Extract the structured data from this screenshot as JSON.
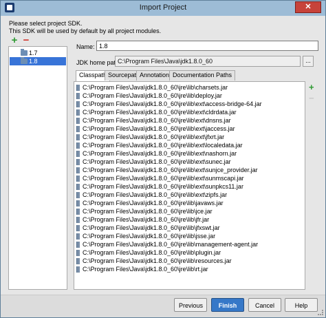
{
  "window": {
    "title": "Import Project",
    "close_glyph": "✕"
  },
  "header": {
    "line1": "Please select project SDK.",
    "line2": "This SDK will be used by default by all project modules."
  },
  "toolbar": {
    "add_glyph": "+",
    "remove_glyph": "−"
  },
  "sdk_list": {
    "items": [
      {
        "label": "1.7"
      },
      {
        "label": "1.8",
        "selected": true
      }
    ]
  },
  "form": {
    "name_label": "Name:",
    "name_value": "1.8",
    "home_label": "JDK home path:",
    "home_value": "C:\\Program Files\\Java\\jdk1.8.0_60",
    "browse_glyph": "..."
  },
  "tabs": [
    {
      "label": "Classpath",
      "active": true
    },
    {
      "label": "Sourcepath"
    },
    {
      "label": "Annotations"
    },
    {
      "label": "Documentation Paths"
    }
  ],
  "classpath": [
    "C:\\Program Files\\Java\\jdk1.8.0_60\\jre\\lib\\charsets.jar",
    "C:\\Program Files\\Java\\jdk1.8.0_60\\jre\\lib\\deploy.jar",
    "C:\\Program Files\\Java\\jdk1.8.0_60\\jre\\lib\\ext\\access-bridge-64.jar",
    "C:\\Program Files\\Java\\jdk1.8.0_60\\jre\\lib\\ext\\cldrdata.jar",
    "C:\\Program Files\\Java\\jdk1.8.0_60\\jre\\lib\\ext\\dnsns.jar",
    "C:\\Program Files\\Java\\jdk1.8.0_60\\jre\\lib\\ext\\jaccess.jar",
    "C:\\Program Files\\Java\\jdk1.8.0_60\\jre\\lib\\ext\\jfxrt.jar",
    "C:\\Program Files\\Java\\jdk1.8.0_60\\jre\\lib\\ext\\localedata.jar",
    "C:\\Program Files\\Java\\jdk1.8.0_60\\jre\\lib\\ext\\nashorn.jar",
    "C:\\Program Files\\Java\\jdk1.8.0_60\\jre\\lib\\ext\\sunec.jar",
    "C:\\Program Files\\Java\\jdk1.8.0_60\\jre\\lib\\ext\\sunjce_provider.jar",
    "C:\\Program Files\\Java\\jdk1.8.0_60\\jre\\lib\\ext\\sunmscapi.jar",
    "C:\\Program Files\\Java\\jdk1.8.0_60\\jre\\lib\\ext\\sunpkcs11.jar",
    "C:\\Program Files\\Java\\jdk1.8.0_60\\jre\\lib\\ext\\zipfs.jar",
    "C:\\Program Files\\Java\\jdk1.8.0_60\\jre\\lib\\javaws.jar",
    "C:\\Program Files\\Java\\jdk1.8.0_60\\jre\\lib\\jce.jar",
    "C:\\Program Files\\Java\\jdk1.8.0_60\\jre\\lib\\jfr.jar",
    "C:\\Program Files\\Java\\jdk1.8.0_60\\jre\\lib\\jfxswt.jar",
    "C:\\Program Files\\Java\\jdk1.8.0_60\\jre\\lib\\jsse.jar",
    "C:\\Program Files\\Java\\jdk1.8.0_60\\jre\\lib\\management-agent.jar",
    "C:\\Program Files\\Java\\jdk1.8.0_60\\jre\\lib\\plugin.jar",
    "C:\\Program Files\\Java\\jdk1.8.0_60\\jre\\lib\\resources.jar",
    "C:\\Program Files\\Java\\jdk1.8.0_60\\jre\\lib\\rt.jar"
  ],
  "side_toolbar": {
    "add_glyph": "+",
    "remove_glyph": "−"
  },
  "buttons": {
    "previous": "Previous",
    "finish": "Finish",
    "cancel": "Cancel",
    "help": "Help"
  },
  "colors": {
    "selection": "#3874d8",
    "add": "#2e9a33",
    "remove": "#d0342c",
    "primary_button": "#3678c8"
  }
}
